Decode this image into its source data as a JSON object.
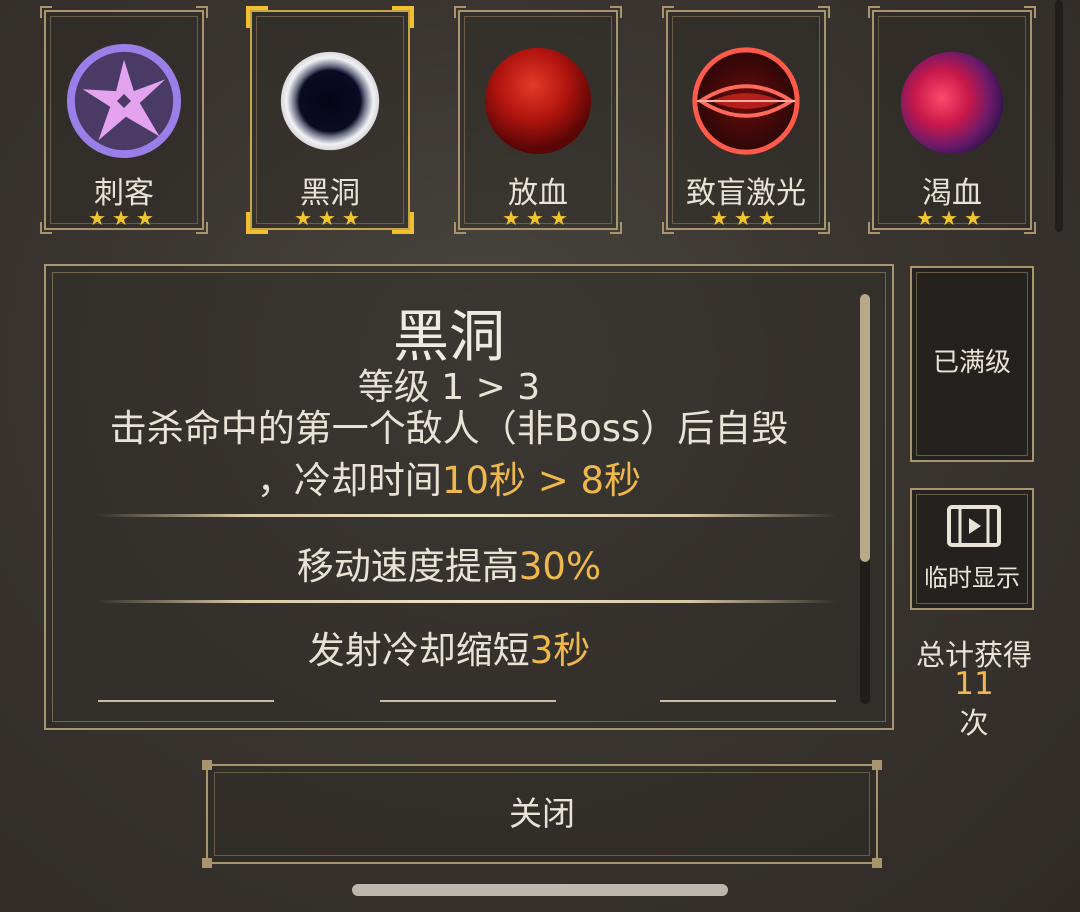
{
  "skills": [
    {
      "name": "刺客",
      "stars": "★★★",
      "icon": "shuriken-icon"
    },
    {
      "name": "黑洞",
      "stars": "★★★",
      "icon": "black-hole-icon",
      "selected": true
    },
    {
      "name": "放血",
      "stars": "★★★",
      "icon": "blood-orb-icon"
    },
    {
      "name": "致盲激光",
      "stars": "★★★",
      "icon": "laser-orb-icon"
    },
    {
      "name": "渴血",
      "stars": "★★★",
      "icon": "crimson-orb-icon"
    }
  ],
  "detail": {
    "title": "黑洞",
    "level": "等级 1 > 3",
    "desc_line1": "击杀命中的第一个敌人（非Boss）后自毁",
    "desc_line2_prefix": "，冷却时间",
    "desc_line2_highlight": "10秒 > 8秒",
    "bonuses": [
      {
        "text": "移动速度提高",
        "highlight": "30%"
      },
      {
        "text": "发射冷却缩短",
        "highlight": "3秒"
      }
    ]
  },
  "side": {
    "maxed_label": "已满级",
    "temp_show_label": "临时显示",
    "temp_show_icon": "video-icon",
    "total_label": "总计获得",
    "total_count": "11",
    "total_unit": "次"
  },
  "close_label": "关闭",
  "colors": {
    "highlight": "#f0b84a",
    "star": "#f2c52e",
    "frame": "#a8956d",
    "selected_frame": "#f0c030"
  }
}
